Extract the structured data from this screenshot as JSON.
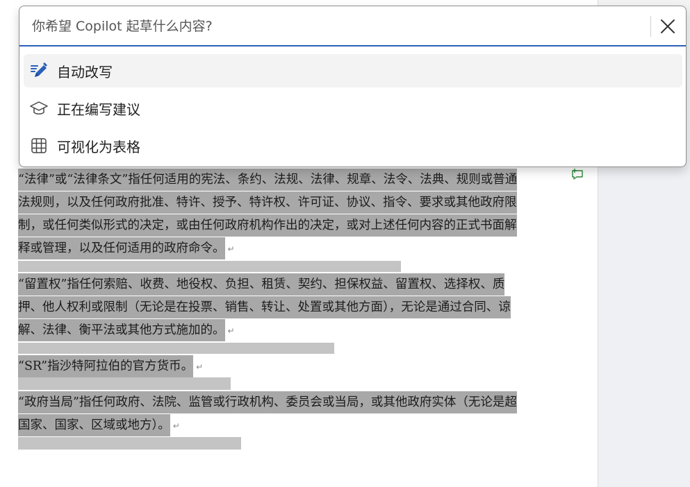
{
  "copilot": {
    "placeholder": "你希望 Copilot 起草什么内容?",
    "menu": [
      {
        "label": "自动改写",
        "icon": "pen-sparkle-icon"
      },
      {
        "label": "正在编写建议",
        "icon": "graduation-cap-icon"
      },
      {
        "label": "可视化为表格",
        "icon": "table-grid-icon"
      }
    ]
  },
  "document": {
    "paragraphs": [
      "“法律”或“法律条文”指任何适用的宪法、条约、法规、法律、规章、法令、法典、规则或普通法规则，以及任何政府批准、特许、授予、特许权、许可证、协议、指令、要求或其他政府限制，或任何类似形式的决定，或由任何政府机构作出的决定，或对上述任何内容的正式书面解释或管理，以及任何适用的政府命令。",
      "“留置权”指任何索赔、收费、地役权、负担、租赁、契约、担保权益、留置权、选择权、质押、他人权利或限制（无论是在投票、销售、转让、处置或其他方面），无论是通过合同、谅解、法律、衡平法或其他方式施加的。",
      "“SR”指沙特阿拉伯的官方货币。",
      "“政府当局”指任何政府、法院、监管或行政机构、委员会或当局，或其他政府实体（无论是超国家、国家、区域或地方）。"
    ],
    "paragraph_mark": "↵"
  },
  "colors": {
    "accent": "#2a5fb8",
    "selection": "#a8a8a8",
    "comment_green": "#2e8b3a"
  }
}
